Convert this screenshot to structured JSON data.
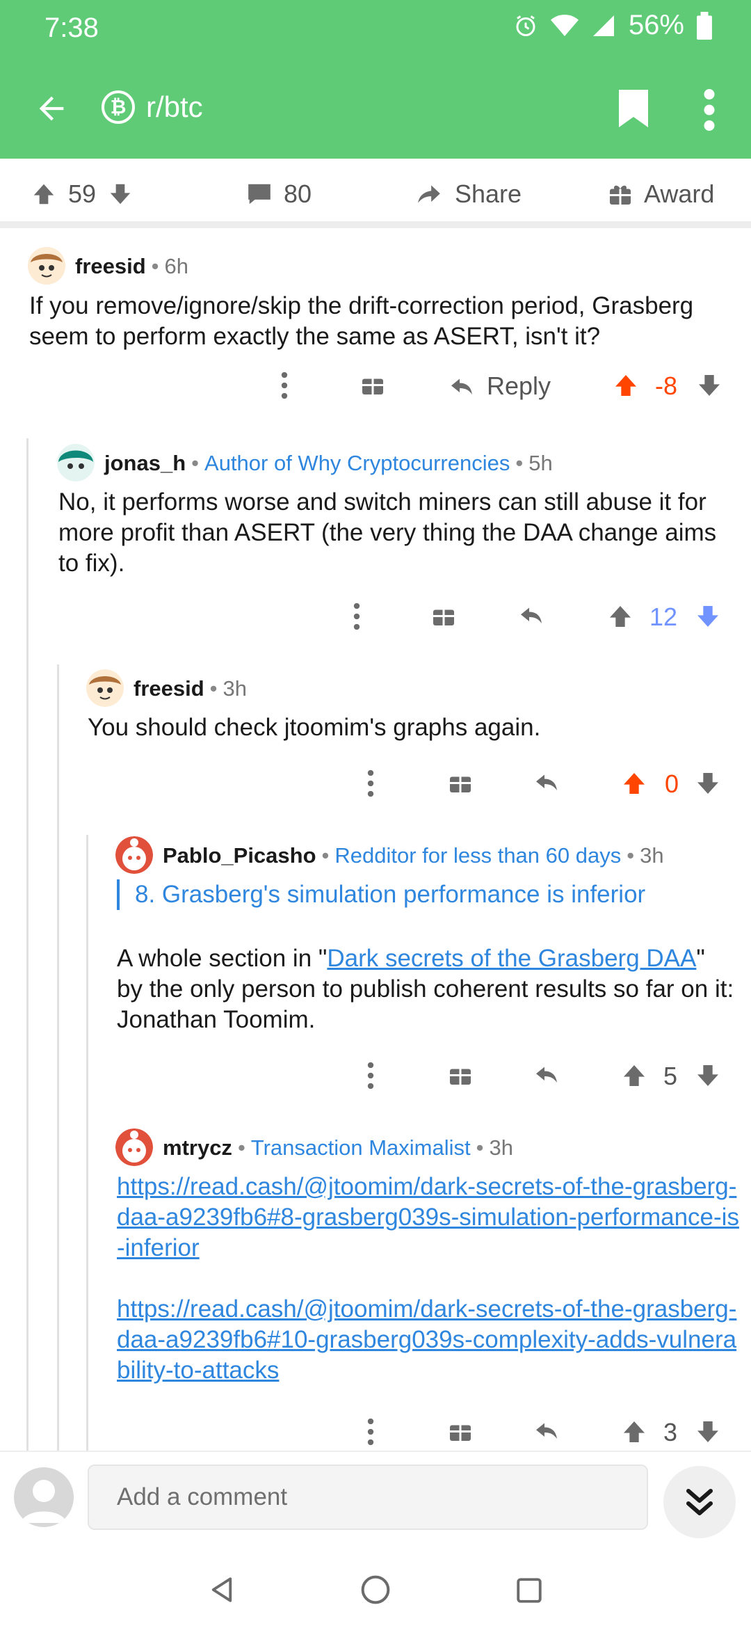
{
  "status": {
    "time": "7:38",
    "battery": "56%"
  },
  "header": {
    "subreddit": "r/btc",
    "sub_icon_letter": "₿"
  },
  "post_actions": {
    "upvotes": "59",
    "comments": "80",
    "share": "Share",
    "award": "Award"
  },
  "comments": [
    {
      "user": "freesid",
      "flair": "",
      "age": "6h",
      "text": "If you remove/ignore/skip the drift-correction period, Grasberg seem to perform exactly the same as ASERT, isn't it?",
      "reply_label": "Reply",
      "score": "-8",
      "vote": "up"
    },
    {
      "user": "jonas_h",
      "flair": "Author of Why Cryptocurrencies",
      "age": "5h",
      "text": "No, it performs worse and switch miners can still abuse it for more profit than ASERT (the very thing the DAA change aims to fix).",
      "score": "12",
      "vote": "down"
    },
    {
      "user": "freesid",
      "flair": "",
      "age": "3h",
      "text": "You should check jtoomim's graphs again.",
      "score": "0",
      "vote": "up"
    },
    {
      "user": "Pablo_Picasho",
      "flair": "Redditor for less than 60 days",
      "age": "3h",
      "quote": "8. Grasberg's simulation performance is inferior",
      "text_before": "A whole section in \"",
      "link": "Dark secrets of the Grasberg DAA",
      "text_after": "\" by the only person to publish coherent results so far on it: Jonathan Toomim.",
      "score": "5",
      "vote": "none"
    },
    {
      "user": "mtrycz",
      "flair": "Transaction Maximalist",
      "age": "3h",
      "link1": "https://read.cash/@jtoomim/dark-secrets-of-the-grasberg-daa-a9239fb6#8-grasberg039s-simulation-performance-is-inferior",
      "link2": "https://read.cash/@jtoomim/dark-secrets-of-the-grasberg-daa-a9239fb6#10-grasberg039s-complexity-adds-vulnerability-to-attacks",
      "score": "3",
      "vote": "none"
    }
  ],
  "composer": {
    "placeholder": "Add a comment"
  },
  "colors": {
    "header": "#5fcb77",
    "upvote": "#ff4500",
    "downvote": "#7193ff",
    "link": "#2e86de"
  }
}
